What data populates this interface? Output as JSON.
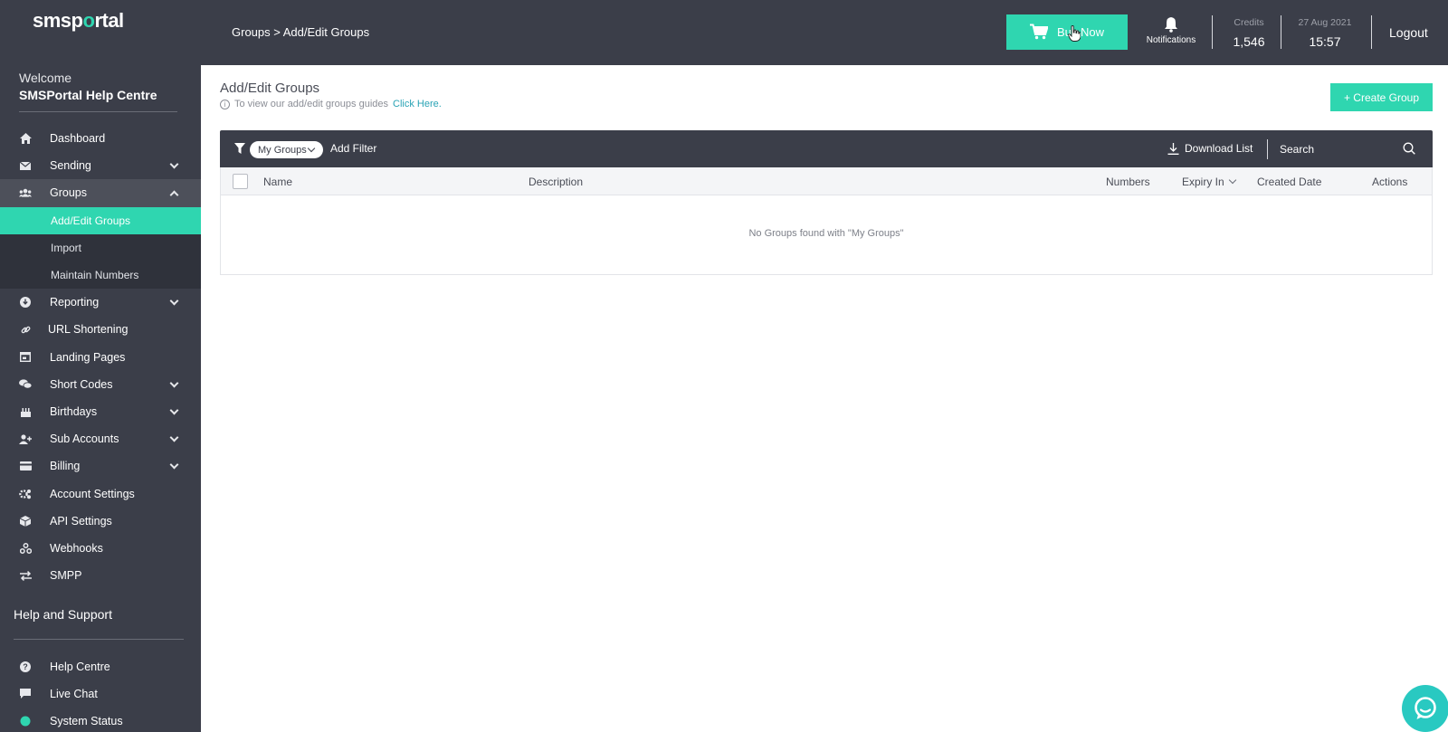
{
  "brand": {
    "logo_pre": "smsp",
    "logo_o": "o",
    "logo_post": "rtal",
    "accent": "#2fd6b0",
    "sidebar_bg": "#3b3e49"
  },
  "sidebar": {
    "welcome": "Welcome",
    "account_name": "SMSPortal Help Centre",
    "items": [
      {
        "label": "Dashboard",
        "icon": "home-icon"
      },
      {
        "label": "Sending",
        "icon": "envelope-icon"
      },
      {
        "label": "Groups",
        "icon": "users-icon"
      },
      {
        "label": "Reporting",
        "icon": "download-circle-icon"
      },
      {
        "label": "URL Shortening",
        "icon": "link-icon"
      },
      {
        "label": "Landing Pages",
        "icon": "window-icon"
      },
      {
        "label": "Short Codes",
        "icon": "comments-icon"
      },
      {
        "label": "Birthdays",
        "icon": "cake-icon"
      },
      {
        "label": "Sub Accounts",
        "icon": "user-plus-icon"
      },
      {
        "label": "Billing",
        "icon": "credit-card-icon"
      },
      {
        "label": "Account Settings",
        "icon": "cogs-icon"
      },
      {
        "label": "API Settings",
        "icon": "cube-icon"
      },
      {
        "label": "Webhooks",
        "icon": "webhook-icon"
      },
      {
        "label": "SMPP",
        "icon": "exchange-icon"
      }
    ],
    "groups_sub": [
      {
        "label": "Add/Edit Groups"
      },
      {
        "label": "Import"
      },
      {
        "label": "Maintain Numbers"
      }
    ],
    "help_title": "Help and Support",
    "help_items": [
      {
        "label": "Help Centre",
        "icon": "question-circle-icon"
      },
      {
        "label": "Live Chat",
        "icon": "chat-icon"
      },
      {
        "label": "System Status",
        "icon": "status-dot-icon"
      }
    ]
  },
  "topbar": {
    "breadcrumb": "Groups > Add/Edit Groups",
    "buy_now": "Buy Now",
    "notifications": "Notifications",
    "credits_label": "Credits",
    "credits_value": "1,546",
    "date": "27 Aug 2021",
    "time": "15:57",
    "logout": "Logout"
  },
  "main": {
    "title": "Add/Edit Groups",
    "info_text": "To view our add/edit groups guides",
    "info_link": "Click Here.",
    "create_button": "+ Create Group",
    "filter": {
      "pill": "My Groups",
      "add_filter": "Add Filter",
      "download": "Download List",
      "search_placeholder": "Search"
    },
    "table": {
      "columns": [
        "Name",
        "Description",
        "Numbers",
        "Expiry In",
        "Created Date",
        "Actions"
      ],
      "empty_message": "No Groups found with \"My Groups\""
    }
  }
}
